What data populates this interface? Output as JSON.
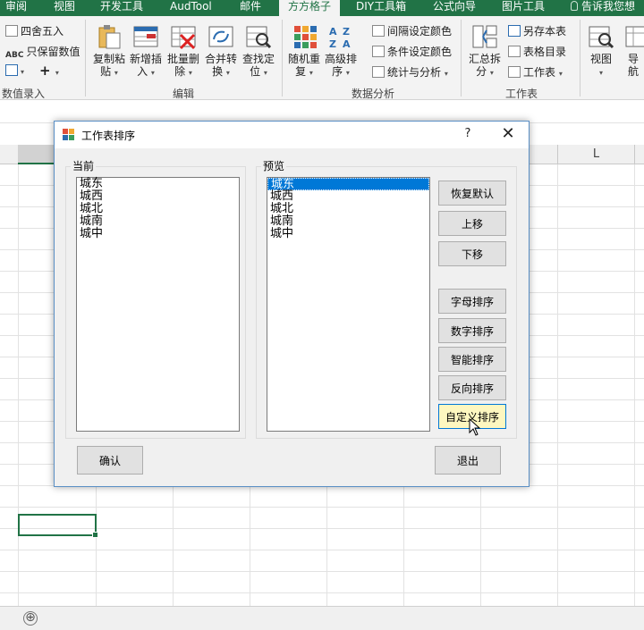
{
  "ribbon_tabs": [
    {
      "label": "审阅"
    },
    {
      "label": "视图"
    },
    {
      "label": "开发工具"
    },
    {
      "label": "AudTool"
    },
    {
      "label": "邮件"
    },
    {
      "label": "方方格子"
    },
    {
      "label": "DIY工具箱"
    },
    {
      "label": "公式向导"
    },
    {
      "label": "图片工具"
    },
    {
      "label": "告诉我您想"
    }
  ],
  "ribbon": {
    "left_items": {
      "round": "四舍五入",
      "keep_value": "只保留数值",
      "plus": "+"
    },
    "group_data_entry": "数值录入",
    "edit_buttons": [
      {
        "line1": "复制粘",
        "line2": "贴"
      },
      {
        "line1": "新增插",
        "line2": "入"
      },
      {
        "line1": "批量删",
        "line2": "除"
      },
      {
        "line1": "合并转",
        "line2": "换"
      },
      {
        "line1": "查找定",
        "line2": "位"
      }
    ],
    "group_edit": "编辑",
    "analysis_buttons": [
      {
        "line1": "随机重",
        "line2": "复"
      },
      {
        "line1": "高级排",
        "line2": "序"
      }
    ],
    "analysis_small": {
      "interval_color": "间隔设定颜色",
      "cond_color": "条件设定颜色",
      "stats": "统计与分析"
    },
    "group_analysis": "数据分析",
    "sheet_buttons": {
      "summary_line1": "汇总拆",
      "summary_line2": "分",
      "save_sheet": "另存本表",
      "sheet_dir": "表格目录",
      "worksheet": "工作表"
    },
    "group_sheet": "工作表",
    "view_buttons": {
      "view": "视图",
      "nav_line1": "导",
      "nav_line2": "航"
    }
  },
  "sheet": {
    "column_L": "L",
    "add_sheet": "⊕"
  },
  "dialog": {
    "title": "工作表排序",
    "help": "?",
    "close": "✕",
    "current_label": "当前",
    "current_items": [
      "城东",
      "城西",
      "城北",
      "城南",
      "城中"
    ],
    "preview_label": "预览",
    "preview_items": [
      "城东",
      "城西",
      "城北",
      "城南",
      "城中"
    ],
    "selected_index": 0,
    "buttons": {
      "restore": "恢复默认",
      "move_up": "上移",
      "move_down": "下移",
      "alpha_sort": "字母排序",
      "numeric_sort": "数字排序",
      "smart_sort": "智能排序",
      "reverse_sort": "反向排序",
      "custom_sort": "自定义排序",
      "confirm": "确认",
      "exit": "退出"
    }
  },
  "colors": {
    "excel_green": "#217346",
    "selection_blue": "#0078d7",
    "hover_yellow": "#fdf7c0"
  }
}
